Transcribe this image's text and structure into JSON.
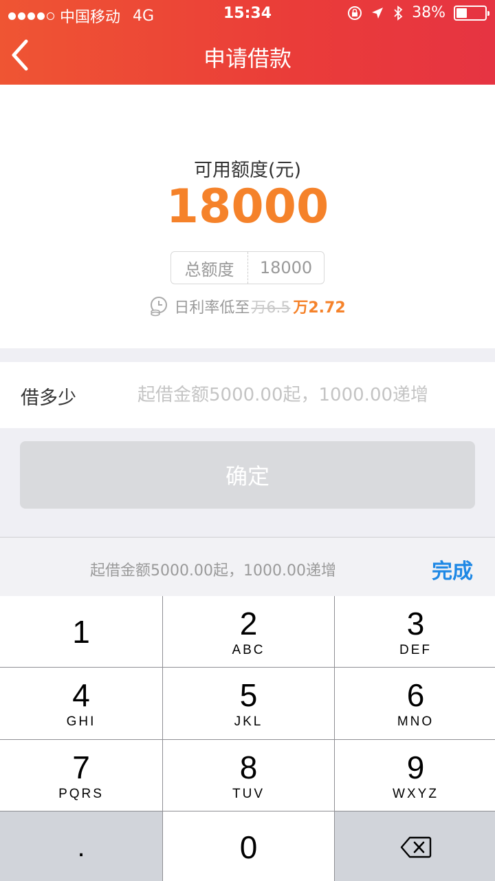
{
  "status_bar": {
    "carrier": "中国移动",
    "network": "4G",
    "time": "15:34",
    "battery": "38%",
    "battery_level": 0.38
  },
  "nav": {
    "title": "申请借款",
    "back_icon": "chevron-left-icon"
  },
  "quota": {
    "label": "可用额度(元)",
    "value": "18000",
    "total_label": "总额度",
    "total_value": "18000",
    "rate_prefix": "日利率低至",
    "rate_old": "万6.5",
    "rate_new": "万2.72"
  },
  "loan_input": {
    "label": "借多少",
    "placeholder": "起借金额5000.00起，1000.00递增",
    "value": ""
  },
  "confirm": {
    "label": "确定"
  },
  "keyboard": {
    "hint": "起借金额5000.00起，1000.00递增",
    "done": "完成",
    "keys": [
      {
        "num": "1",
        "sub": ""
      },
      {
        "num": "2",
        "sub": "ABC"
      },
      {
        "num": "3",
        "sub": "DEF"
      },
      {
        "num": "4",
        "sub": "GHI"
      },
      {
        "num": "5",
        "sub": "JKL"
      },
      {
        "num": "6",
        "sub": "MNO"
      },
      {
        "num": "7",
        "sub": "PQRS"
      },
      {
        "num": "8",
        "sub": "TUV"
      },
      {
        "num": "9",
        "sub": "WXYZ"
      },
      {
        "num": ".",
        "sub": ""
      },
      {
        "num": "0",
        "sub": ""
      }
    ],
    "delete_icon": "backspace-icon"
  },
  "colors": {
    "header_start": "#ef5533",
    "header_end": "#e63442",
    "accent_orange": "#f5822a",
    "done_blue": "#1e88e5",
    "button_disabled": "#d9dadd"
  }
}
